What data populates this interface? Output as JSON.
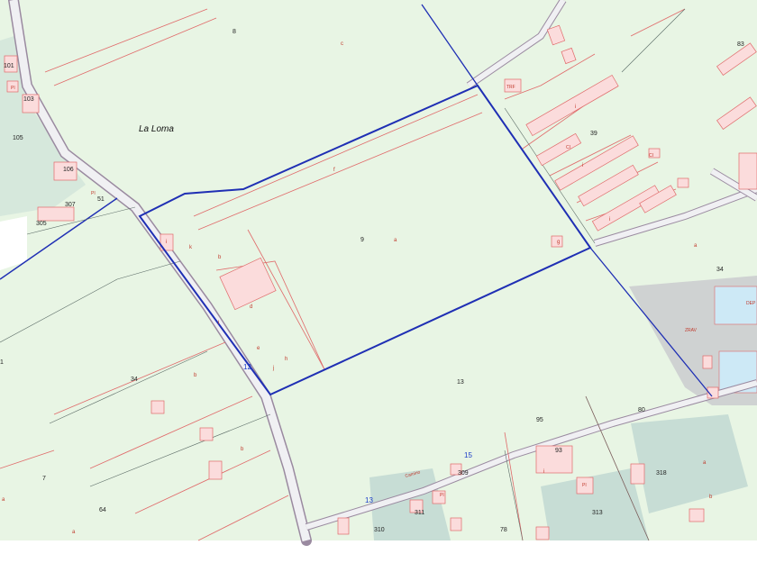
{
  "map": {
    "place_name": "La Loma",
    "colors": {
      "land": "#e8f5e4",
      "building": "#fbdcdc",
      "shaded": "#c7ddd5",
      "grey_area": "#cfd2d2",
      "water": "#cde9f6",
      "road": "#f0f0f3",
      "parcel_line": "#e06a6a",
      "highlight": "#1f2fb4"
    },
    "parcel_numbers": {
      "p8": "8",
      "p83": "83",
      "p39": "39",
      "p9": "9",
      "p34a": "34",
      "p34b": "34",
      "p13": "13",
      "p80": "80",
      "p95": "95",
      "p309": "309",
      "p318": "318",
      "p311": "311",
      "p313": "313",
      "p310": "310",
      "p78": "78",
      "p64": "64",
      "p7": "7",
      "p101": "101",
      "p103": "103",
      "p105": "105",
      "p106": "106",
      "p307": "307",
      "p305": "305",
      "p51": "51",
      "p93": "93",
      "p1": "1"
    },
    "sub_letters": {
      "c": "c",
      "f": "f",
      "a": "a",
      "b": "b",
      "d": "d",
      "e": "e",
      "h": "h",
      "i": "i",
      "k": "k",
      "l": "l",
      "j": "j",
      "g": "g"
    },
    "building_labels": {
      "trf": "TRF",
      "zrav": "ZRAV",
      "dep": "DEP",
      "pi": "PI",
      "ci": "CI"
    },
    "road_codes": {
      "r15": "15",
      "r13": "13",
      "r12": "12"
    },
    "road_name": "Camino"
  }
}
